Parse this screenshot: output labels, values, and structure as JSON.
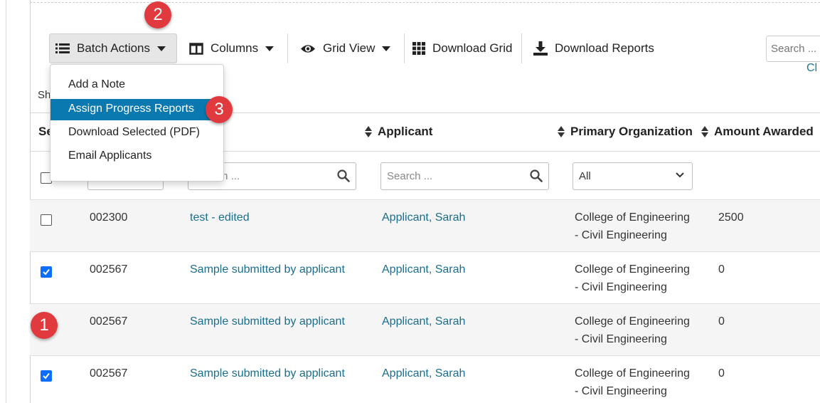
{
  "toolbar": {
    "batch_actions": "Batch Actions",
    "columns": "Columns",
    "grid_view": "Grid View",
    "download_grid": "Download Grid",
    "download_reports": "Download Reports",
    "search_placeholder": "Search ...",
    "clear_link": "Cl"
  },
  "shown_text": "Sh",
  "batch_menu": {
    "items": [
      {
        "label": "Add a Note",
        "active": false
      },
      {
        "label": "Assign Progress Reports",
        "active": true
      },
      {
        "label": "Download Selected (PDF)",
        "active": false
      },
      {
        "label": "Email Applicants",
        "active": false
      }
    ]
  },
  "table": {
    "headers": {
      "select": "Se",
      "applicant": "Applicant",
      "primary_org": "Primary Organization",
      "amount": "Amount Awarded"
    },
    "filters": {
      "title_placeholder": "Search ...",
      "applicant_placeholder": "Search ...",
      "org_value": "All"
    },
    "rows": [
      {
        "checked": false,
        "id": "002300",
        "title": "test - edited",
        "applicant": "Applicant, Sarah",
        "org_line1": "College of Engineering",
        "org_line2": "- Civil Engineering",
        "amount": "2500"
      },
      {
        "checked": true,
        "id": "002567",
        "title": "Sample submitted by applicant",
        "applicant": "Applicant, Sarah",
        "org_line1": "College of Engineering",
        "org_line2": "- Civil Engineering",
        "amount": "0"
      },
      {
        "checked": false,
        "id": "002567",
        "title": "Sample submitted by applicant",
        "applicant": "Applicant, Sarah",
        "org_line1": "College of Engineering",
        "org_line2": "- Civil Engineering",
        "amount": "0"
      },
      {
        "checked": true,
        "id": "002567",
        "title": "Sample submitted by applicant",
        "applicant": "Applicant, Sarah",
        "org_line1": "College of Engineering",
        "org_line2": "- Civil Engineering",
        "amount": "0"
      }
    ]
  },
  "callouts": [
    "1",
    "2",
    "3"
  ],
  "colors": {
    "accent": "#0a79b0",
    "link": "#1a6e8e",
    "callout": "#e0393e",
    "checkbox": "#0d6efd"
  },
  "icons": [
    "list-icon",
    "columns-icon",
    "eye-icon",
    "grid-icon",
    "download-icon",
    "search-icon",
    "chevron-down-icon"
  ]
}
